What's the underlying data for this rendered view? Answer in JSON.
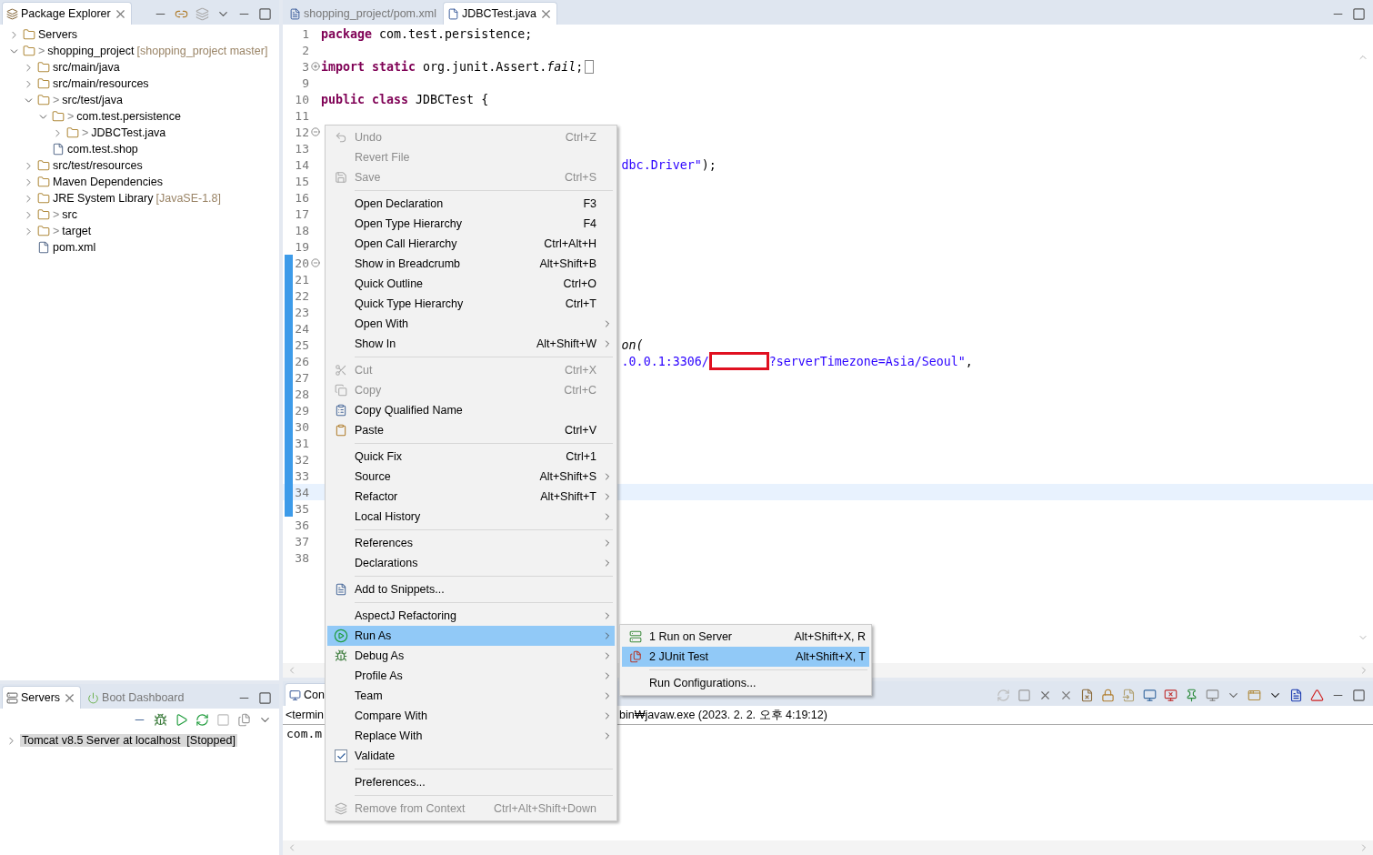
{
  "package_explorer": {
    "title": "Package Explorer",
    "tree": [
      {
        "label": "Servers",
        "kind": "folder",
        "expanded": false
      },
      {
        "label": "shopping_project",
        "prefix": ">",
        "decoration": "[shopping_project master]",
        "kind": "folder",
        "expanded": true,
        "children": [
          {
            "label": "src/main/java",
            "kind": "folder",
            "expanded": false
          },
          {
            "label": "src/main/resources",
            "kind": "folder",
            "expanded": false
          },
          {
            "label": "src/test/java",
            "prefix": ">",
            "kind": "folder",
            "expanded": true,
            "children": [
              {
                "label": "com.test.persistence",
                "prefix": ">",
                "kind": "folder",
                "expanded": true,
                "children": [
                  {
                    "label": "JDBCTest.java",
                    "prefix": ">",
                    "kind": "folder",
                    "expanded": false
                  }
                ]
              },
              {
                "label": "com.test.shop",
                "kind": "leaf"
              }
            ]
          },
          {
            "label": "src/test/resources",
            "kind": "folder",
            "expanded": false
          },
          {
            "label": "Maven Dependencies",
            "kind": "folder",
            "expanded": false
          },
          {
            "label": "JRE System Library",
            "decoration": "[JavaSE-1.8]",
            "kind": "folder",
            "expanded": false
          },
          {
            "label": "src",
            "prefix": ">",
            "kind": "folder",
            "expanded": false
          },
          {
            "label": "target",
            "prefix": ">",
            "kind": "folder",
            "expanded": false
          },
          {
            "label": "pom.xml",
            "kind": "leaf"
          }
        ]
      }
    ]
  },
  "editor": {
    "tabs": [
      {
        "label": "shopping_project/pom.xml",
        "selected": false
      },
      {
        "label": "JDBCTest.java",
        "selected": true
      }
    ],
    "lines": [
      {
        "n": "1",
        "tokens": [
          {
            "text": "package",
            "kind": "keyword"
          },
          {
            "text": " com.test.persistence;",
            "kind": "plain"
          }
        ],
        "in_range": false,
        "current": false
      },
      {
        "n": "2",
        "in_range": false,
        "current": false
      },
      {
        "n": "3",
        "collapsed": true,
        "tokens": [
          {
            "text": "import static",
            "kind": "keyword"
          },
          {
            "text": " org.junit.Assert.",
            "kind": "plain"
          },
          {
            "text": "fail",
            "kind": "italic"
          },
          {
            "text": ";",
            "kind": "plain"
          },
          {
            "kind": "folded"
          }
        ],
        "in_range": false,
        "current": false
      },
      {
        "n": "9",
        "in_range": false,
        "current": false
      },
      {
        "n": "10",
        "tokens": [
          {
            "text": "public class",
            "kind": "keyword"
          },
          {
            "text": " JDBCTest {",
            "kind": "plain"
          }
        ],
        "in_range": false,
        "current": false
      },
      {
        "n": "11",
        "in_range": false,
        "current": false
      },
      {
        "n": "12",
        "collapsed": false,
        "in_range": false,
        "current": false
      },
      {
        "n": "13",
        "in_range": false,
        "current": false
      },
      {
        "n": "14",
        "clipped": true,
        "tokens": [
          {
            "text": "dbc.Driver\"",
            "kind": "string"
          },
          {
            "text": ");",
            "kind": "plain"
          }
        ],
        "in_range": false,
        "current": false
      },
      {
        "n": "15",
        "in_range": false,
        "current": false
      },
      {
        "n": "16",
        "in_range": false,
        "current": false
      },
      {
        "n": "17",
        "in_range": false,
        "current": false
      },
      {
        "n": "18",
        "in_range": false,
        "current": false
      },
      {
        "n": "19",
        "in_range": false,
        "current": false
      },
      {
        "n": "20",
        "collapsed": false,
        "in_range": true,
        "current": false
      },
      {
        "n": "21",
        "in_range": true,
        "current": false
      },
      {
        "n": "22",
        "in_range": true,
        "current": false
      },
      {
        "n": "23",
        "in_range": true,
        "current": false
      },
      {
        "n": "24",
        "in_range": true,
        "current": false
      },
      {
        "n": "25",
        "clipped": true,
        "tokens": [
          {
            "text": "on(",
            "kind": "italic"
          }
        ],
        "in_range": true,
        "current": false
      },
      {
        "n": "26",
        "clipped": true,
        "tokens": [
          {
            "text": ".0.0.1:3306/",
            "kind": "string"
          },
          {
            "kind": "redacted"
          },
          {
            "text": "?serverTimezone=Asia/Seoul\"",
            "kind": "string"
          },
          {
            "text": ",",
            "kind": "plain"
          }
        ],
        "in_range": true,
        "current": false
      },
      {
        "n": "27",
        "in_range": true,
        "current": false
      },
      {
        "n": "28",
        "in_range": true,
        "current": false
      },
      {
        "n": "29",
        "in_range": true,
        "current": false
      },
      {
        "n": "30",
        "in_range": true,
        "current": false
      },
      {
        "n": "31",
        "in_range": true,
        "current": false
      },
      {
        "n": "32",
        "in_range": true,
        "current": false
      },
      {
        "n": "33",
        "in_range": true,
        "current": false
      },
      {
        "n": "34",
        "in_range": true,
        "current": true
      },
      {
        "n": "35",
        "in_range": true,
        "current": false
      },
      {
        "n": "36",
        "in_range": false,
        "current": false
      },
      {
        "n": "37",
        "in_range": false,
        "current": false
      },
      {
        "n": "38",
        "in_range": false,
        "current": false
      }
    ]
  },
  "servers": {
    "tabs": [
      {
        "label": "Servers",
        "selected": true
      },
      {
        "label": "Boot Dashboard",
        "selected": false
      }
    ],
    "rows": [
      {
        "label": "Tomcat v8.5 Server at localhost",
        "status": "[Stopped]",
        "selected": true,
        "expanded": false
      }
    ]
  },
  "console": {
    "tab": "Con",
    "header_left": "<termin",
    "header_right": "bin₩javaw.exe (2023. 2. 2. 오후 4:19:12)",
    "output": "com.m"
  },
  "context_menu": {
    "groups": [
      [
        {
          "label": "Undo",
          "shortcut": "Ctrl+Z",
          "disabled": true,
          "submenu": false,
          "selected": false
        },
        {
          "label": "Revert File",
          "disabled": true,
          "submenu": false,
          "selected": false
        },
        {
          "label": "Save",
          "shortcut": "Ctrl+S",
          "disabled": true,
          "submenu": false,
          "selected": false
        }
      ],
      [
        {
          "label": "Open Declaration",
          "shortcut": "F3",
          "disabled": false,
          "submenu": false,
          "selected": false
        },
        {
          "label": "Open Type Hierarchy",
          "shortcut": "F4",
          "disabled": false,
          "submenu": false,
          "selected": false
        },
        {
          "label": "Open Call Hierarchy",
          "shortcut": "Ctrl+Alt+H",
          "disabled": false,
          "submenu": false,
          "selected": false
        },
        {
          "label": "Show in Breadcrumb",
          "shortcut": "Alt+Shift+B",
          "disabled": false,
          "submenu": false,
          "selected": false
        },
        {
          "label": "Quick Outline",
          "shortcut": "Ctrl+O",
          "disabled": false,
          "submenu": false,
          "selected": false
        },
        {
          "label": "Quick Type Hierarchy",
          "shortcut": "Ctrl+T",
          "disabled": false,
          "submenu": false,
          "selected": false
        },
        {
          "label": "Open With",
          "disabled": false,
          "submenu": true,
          "selected": false
        },
        {
          "label": "Show In",
          "shortcut": "Alt+Shift+W",
          "disabled": false,
          "submenu": true,
          "selected": false
        }
      ],
      [
        {
          "label": "Cut",
          "shortcut": "Ctrl+X",
          "disabled": true,
          "submenu": false,
          "selected": false
        },
        {
          "label": "Copy",
          "shortcut": "Ctrl+C",
          "disabled": true,
          "submenu": false,
          "selected": false
        },
        {
          "label": "Copy Qualified Name",
          "disabled": false,
          "submenu": false,
          "selected": false
        },
        {
          "label": "Paste",
          "shortcut": "Ctrl+V",
          "disabled": false,
          "submenu": false,
          "selected": false
        }
      ],
      [
        {
          "label": "Quick Fix",
          "shortcut": "Ctrl+1",
          "disabled": false,
          "submenu": false,
          "selected": false
        },
        {
          "label": "Source",
          "shortcut": "Alt+Shift+S",
          "disabled": false,
          "submenu": true,
          "selected": false
        },
        {
          "label": "Refactor",
          "shortcut": "Alt+Shift+T",
          "disabled": false,
          "submenu": true,
          "selected": false
        },
        {
          "label": "Local History",
          "disabled": false,
          "submenu": true,
          "selected": false
        }
      ],
      [
        {
          "label": "References",
          "disabled": false,
          "submenu": true,
          "selected": false
        },
        {
          "label": "Declarations",
          "disabled": false,
          "submenu": true,
          "selected": false
        }
      ],
      [
        {
          "label": "Add to Snippets...",
          "disabled": false,
          "submenu": false,
          "selected": false
        }
      ],
      [
        {
          "label": "AspectJ Refactoring",
          "disabled": false,
          "submenu": true,
          "selected": false
        },
        {
          "label": "Run As",
          "disabled": false,
          "submenu": true,
          "selected": true
        },
        {
          "label": "Debug As",
          "disabled": false,
          "submenu": true,
          "selected": false
        },
        {
          "label": "Profile As",
          "disabled": false,
          "submenu": true,
          "selected": false
        },
        {
          "label": "Team",
          "disabled": false,
          "submenu": true,
          "selected": false
        },
        {
          "label": "Compare With",
          "disabled": false,
          "submenu": true,
          "selected": false
        },
        {
          "label": "Replace With",
          "disabled": false,
          "submenu": true,
          "selected": false
        },
        {
          "label": "Validate",
          "kind": "check",
          "checked": true,
          "disabled": false,
          "submenu": false,
          "selected": false
        }
      ],
      [
        {
          "label": "Preferences...",
          "disabled": false,
          "submenu": false,
          "selected": false
        }
      ],
      [
        {
          "label": "Remove from Context",
          "shortcut": "Ctrl+Alt+Shift+Down",
          "disabled": true,
          "submenu": false,
          "selected": false
        }
      ]
    ]
  },
  "run_as_submenu": {
    "groups": [
      [
        {
          "label": "1 Run on Server",
          "shortcut": "Alt+Shift+X, R",
          "selected": false
        },
        {
          "label": "2 JUnit Test",
          "shortcut": "Alt+Shift+X, T",
          "selected": true
        }
      ],
      [
        {
          "label": "Run Configurations...",
          "selected": false
        }
      ]
    ]
  }
}
